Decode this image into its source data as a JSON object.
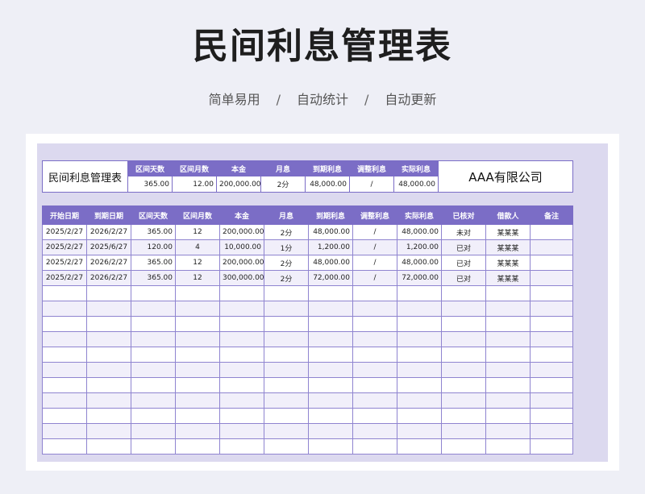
{
  "title": "民间利息管理表",
  "subtitle": [
    "简单易用",
    "自动统计",
    "自动更新"
  ],
  "subtitle_sep": "/",
  "summary": {
    "name": "民间利息管理表",
    "headers": [
      "区间天数",
      "区间月数",
      "本金",
      "月息",
      "到期利息",
      "调整利息",
      "实际利息"
    ],
    "values": [
      "365.00",
      "12.00",
      "200,000.00",
      "2分",
      "48,000.00",
      "/",
      "48,000.00"
    ],
    "company": "AAA有限公司"
  },
  "table": {
    "headers": [
      "开始日期",
      "到期日期",
      "区间天数",
      "区间月数",
      "本金",
      "月息",
      "到期利息",
      "调整利息",
      "实际利息",
      "已核对",
      "借款人",
      "备注"
    ],
    "rows": [
      [
        "2025/2/27",
        "2026/2/27",
        "365.00",
        "12",
        "200,000.00",
        "2分",
        "48,000.00",
        "/",
        "48,000.00",
        "未对",
        "某某某",
        ""
      ],
      [
        "2025/2/27",
        "2025/6/27",
        "120.00",
        "4",
        "10,000.00",
        "1分",
        "1,200.00",
        "/",
        "1,200.00",
        "已对",
        "某某某",
        ""
      ],
      [
        "2025/2/27",
        "2026/2/27",
        "365.00",
        "12",
        "200,000.00",
        "2分",
        "48,000.00",
        "/",
        "48,000.00",
        "已对",
        "某某某",
        ""
      ],
      [
        "2025/2/27",
        "2026/2/27",
        "365.00",
        "12",
        "300,000.00",
        "2分",
        "72,000.00",
        "/",
        "72,000.00",
        "已对",
        "某某某",
        ""
      ]
    ],
    "empty_rows": 11
  },
  "colors": {
    "header": "#7b6dc6",
    "band": "#f1effa",
    "frame": "#dcd9ef"
  }
}
